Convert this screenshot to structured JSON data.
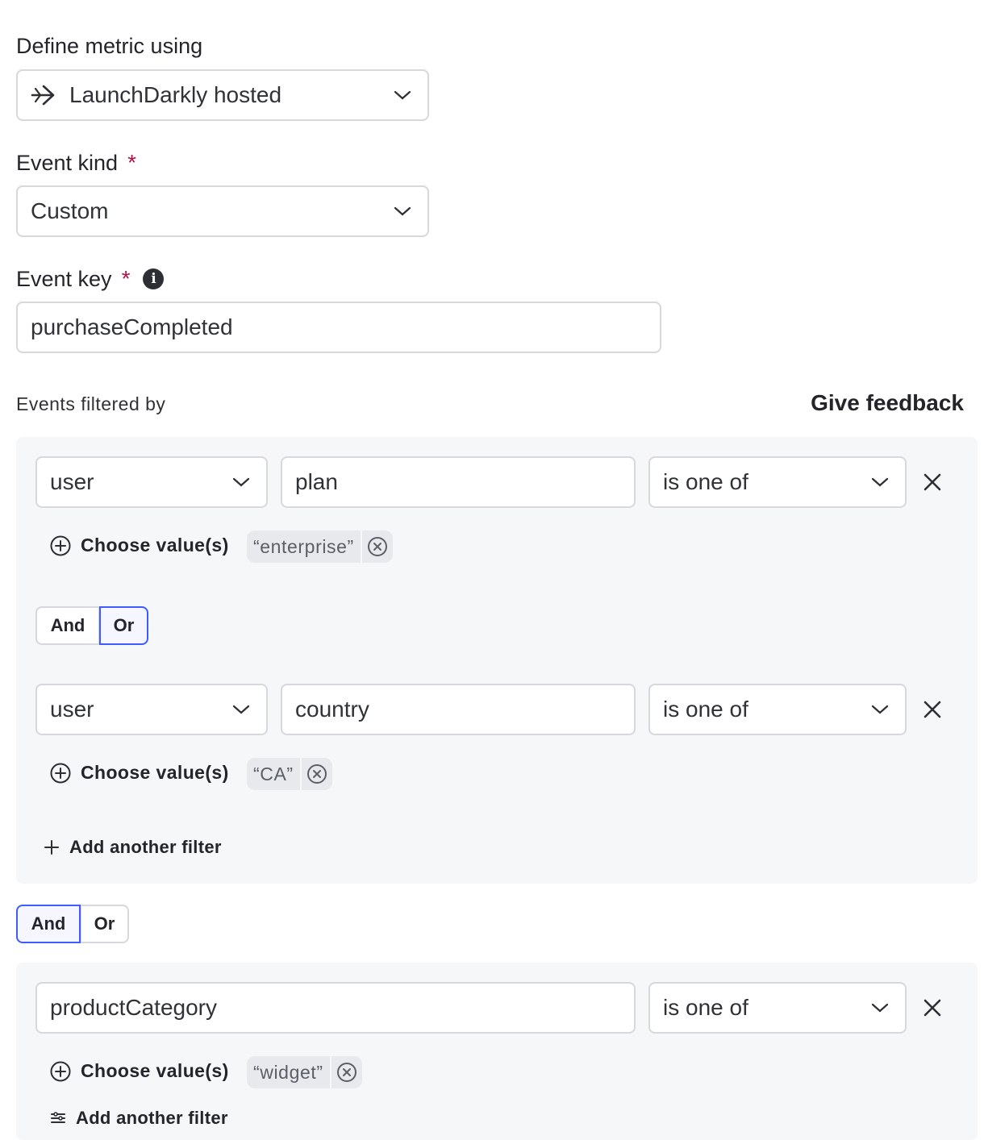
{
  "define_metric": {
    "label": "Define metric using",
    "value": "LaunchDarkly hosted"
  },
  "event_kind": {
    "label": "Event kind",
    "required_mark": "*",
    "value": "Custom"
  },
  "event_key": {
    "label": "Event key",
    "required_mark": "*",
    "info_glyph": "i",
    "value": "purchaseCompleted"
  },
  "filters": {
    "title": "Events filtered by",
    "feedback_link": "Give feedback",
    "group1": {
      "rows": [
        {
          "context": "user",
          "attribute": "plan",
          "operator": "is one of",
          "choose_label": "Choose value(s)",
          "chips": [
            "“enterprise”"
          ]
        },
        {
          "context": "user",
          "attribute": "country",
          "operator": "is one of",
          "choose_label": "Choose value(s)",
          "chips": [
            "“CA”"
          ]
        }
      ],
      "conjunction": {
        "and": "And",
        "or": "Or",
        "selected": "or"
      },
      "add_filter": "Add another filter"
    },
    "group_conjunction": {
      "and": "And",
      "or": "Or",
      "selected": "and"
    },
    "group2": {
      "rows": [
        {
          "attribute": "productCategory",
          "operator": "is one of",
          "choose_label": "Choose value(s)",
          "chips": [
            "“widget”"
          ]
        }
      ],
      "add_filter": "Add another filter"
    }
  },
  "colors": {
    "accent": "#405bff",
    "required": "#b0134a",
    "panel_bg": "#f6f7f9",
    "border": "#d6d8dd"
  }
}
